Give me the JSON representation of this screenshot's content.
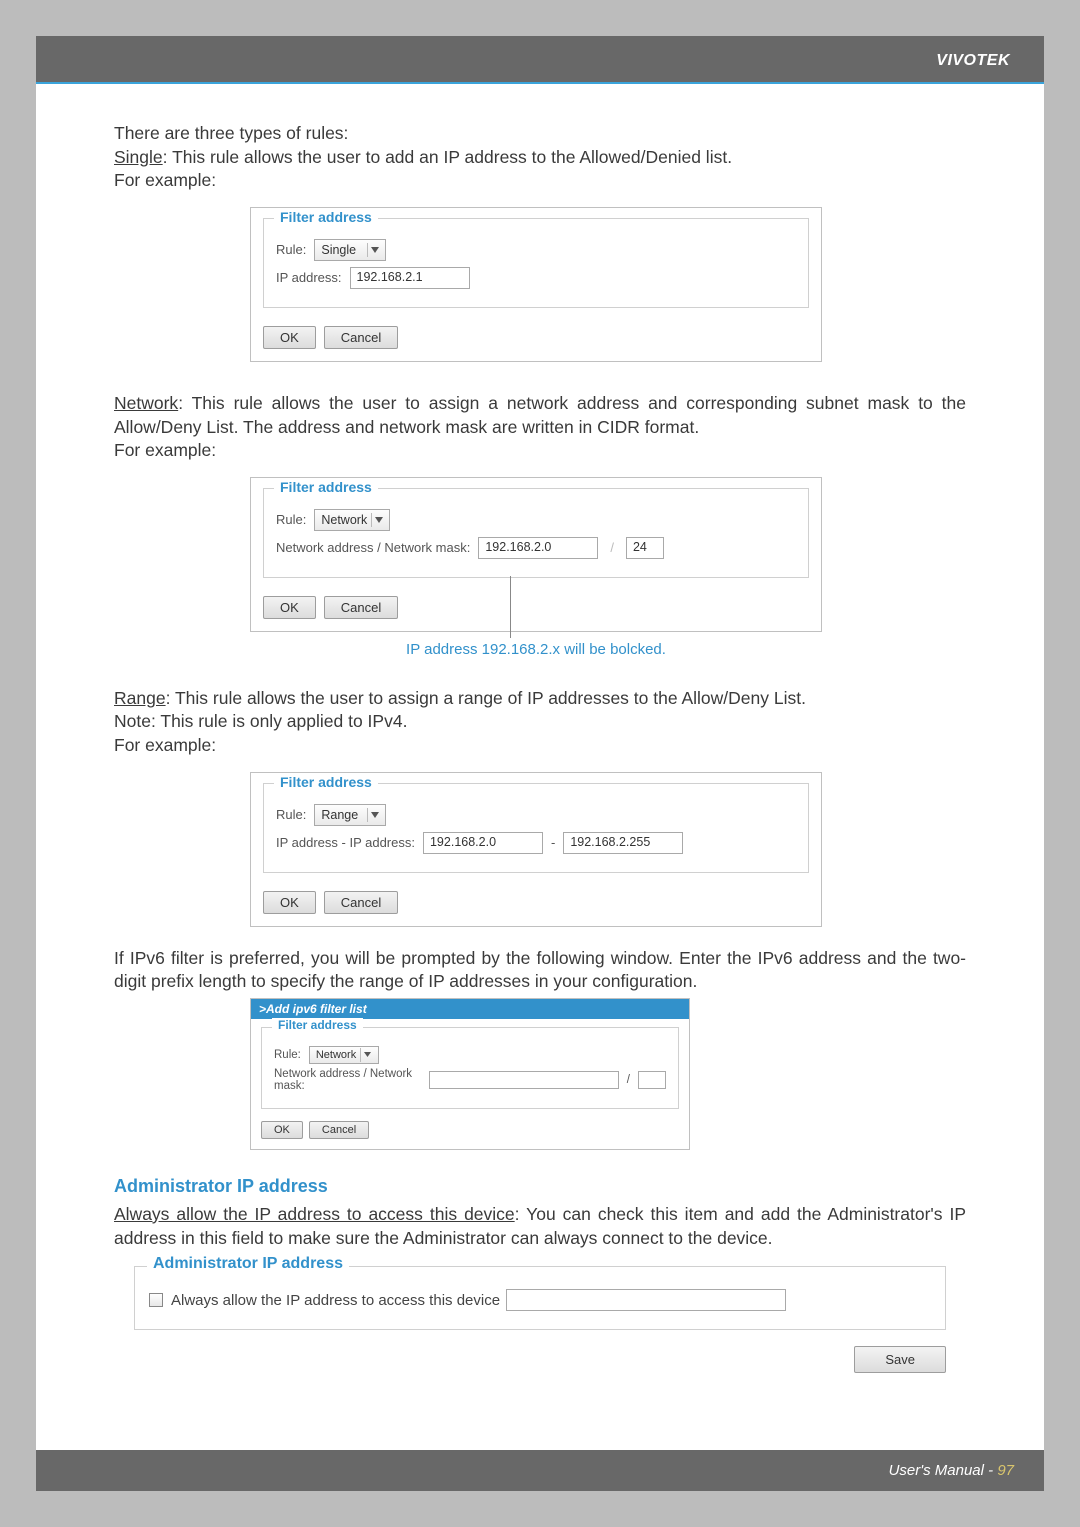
{
  "header": {
    "brand": "VIVOTEK"
  },
  "intro": {
    "line1": "There are three types of rules:",
    "single_label": "Single",
    "single_desc": ": This rule allows the user to add an IP address to the Allowed/Denied list.",
    "for_example": "For example:"
  },
  "dialog_single": {
    "legend": "Filter address",
    "rule_label": "Rule:",
    "rule_value": "Single",
    "ip_label": "IP address:",
    "ip_value": "192.168.2.1",
    "ok": "OK",
    "cancel": "Cancel"
  },
  "network_block": {
    "label": "Network",
    "desc": ": This rule allows the user to assign a network address and corresponding subnet mask to the Allow/Deny List. The address and network mask are written in CIDR format.",
    "for_example": "For example:"
  },
  "dialog_network": {
    "legend": "Filter address",
    "rule_label": "Rule:",
    "rule_value": "Network",
    "mask_label": "Network address / Network mask:",
    "addr": "192.168.2.0",
    "slash": "/",
    "prefix": "24",
    "ok": "OK",
    "cancel": "Cancel",
    "caption": "IP address 192.168.2.x will be bolcked."
  },
  "range_block": {
    "label": "Range",
    "desc": ": This rule allows the user to assign a range of IP addresses to the Allow/Deny List.",
    "note": "Note: This rule is only applied to IPv4.",
    "for_example": "For example:"
  },
  "dialog_range": {
    "legend": "Filter address",
    "rule_label": "Rule:",
    "rule_value": "Range",
    "ip_label": "IP address - IP address:",
    "from": "192.168.2.0",
    "dash": "-",
    "to": "192.168.2.255",
    "ok": "OK",
    "cancel": "Cancel"
  },
  "ipv6_intro": "If IPv6 filter is preferred, you will be prompted by the following window. Enter the IPv6 address and the two-digit prefix length to specify the range of IP addresses in your configuration.",
  "dialog_ipv6": {
    "title": ">Add ipv6 filter list",
    "legend": "Filter address",
    "rule_label": "Rule:",
    "rule_value": "Network",
    "mask_label": "Network address / Network mask:",
    "addr": "",
    "slash": "/",
    "prefix": "",
    "ok": "OK",
    "cancel": "Cancel"
  },
  "admin": {
    "section_title": "Administrator IP address",
    "under_label": "Always allow the IP address to access this device",
    "desc_tail": ": You can check this item and add the Administrator's IP address in this field to make sure the Administrator can always connect to the device.",
    "legend": "Administrator IP address",
    "checkbox_label": "Always allow the IP address to access this device",
    "input_value": "",
    "save": "Save"
  },
  "footer": {
    "text": "User's Manual - ",
    "page": "97"
  }
}
